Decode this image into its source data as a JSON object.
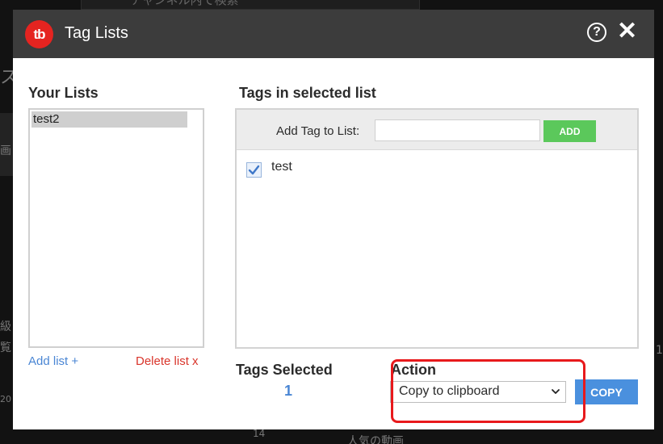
{
  "background": {
    "search_placeholder": "チャンネル内で検索",
    "fragment_1": "ス",
    "fragment_2": "画",
    "fragment_3": "級",
    "fragment_4": "覧",
    "fragment_5": "20",
    "fragment_6": "14",
    "fragment_7": "人気の動画",
    "fragment_8": "1"
  },
  "dialog": {
    "title": "Tag Lists",
    "logo_text": "tb",
    "help_glyph": "?",
    "close_glyph": "✕"
  },
  "your_lists": {
    "heading": "Your Lists",
    "items": [
      "test2"
    ],
    "add_link": "Add list +",
    "delete_link": "Delete list x"
  },
  "tags_panel": {
    "heading": "Tags in selected list",
    "add_label": "Add Tag to List:",
    "add_input_value": "",
    "add_button": "ADD",
    "tags": [
      {
        "label": "test",
        "checked": true
      }
    ]
  },
  "tags_selected": {
    "heading": "Tags Selected",
    "count": "1"
  },
  "action": {
    "heading": "Action",
    "selected_option": "Copy to clipboard",
    "copy_button": "COPY"
  },
  "colors": {
    "titlebar": "#3c3c3c",
    "logo_red": "#e52420",
    "add_green": "#5bc85b",
    "copy_blue": "#4a90de",
    "link_blue": "#4a86d4",
    "link_red": "#d9352b",
    "highlight_red": "#e8191c"
  }
}
